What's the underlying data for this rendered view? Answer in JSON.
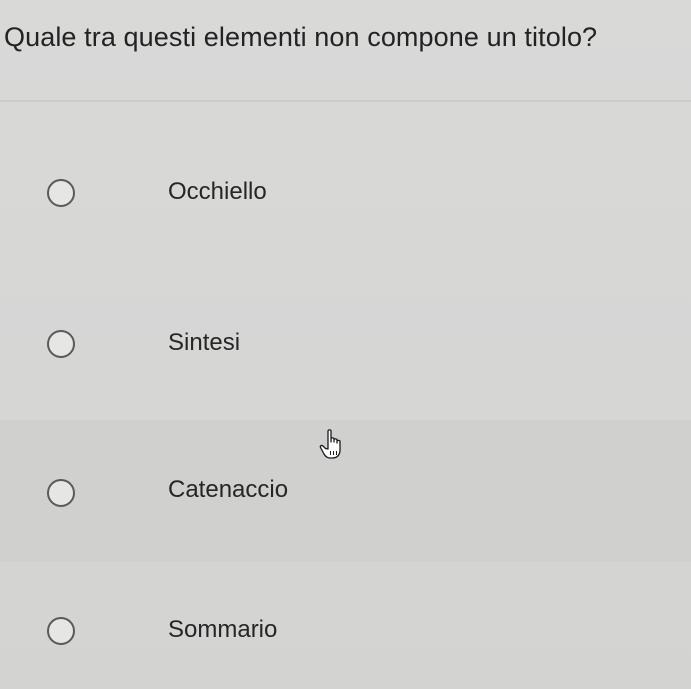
{
  "question": {
    "text": "Quale tra questi elementi non compone un titolo?"
  },
  "options": [
    {
      "label": "Occhiello",
      "selected": false
    },
    {
      "label": "Sintesi",
      "selected": false
    },
    {
      "label": "Catenaccio",
      "selected": false,
      "hovered": true
    },
    {
      "label": "Sommario",
      "selected": false
    }
  ],
  "cursor": {
    "icon": "pointing-hand-cursor-icon"
  }
}
